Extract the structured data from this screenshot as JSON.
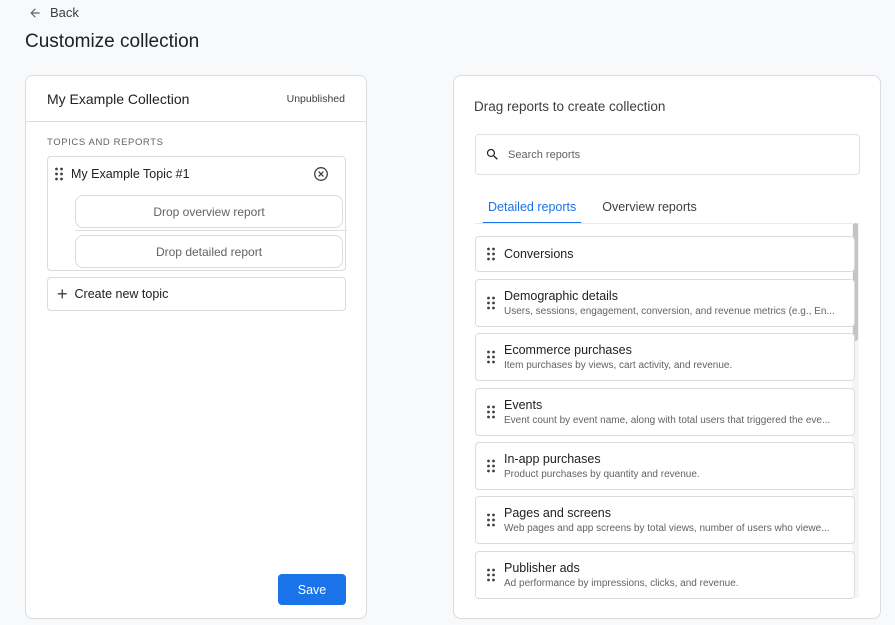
{
  "nav": {
    "back_label": "Back"
  },
  "page": {
    "title": "Customize collection"
  },
  "left_panel": {
    "collection_name": "My Example Collection",
    "status": "Unpublished",
    "section_label": "TOPICS AND REPORTS",
    "topic": {
      "name": "My Example Topic #1",
      "drop_overview": "Drop overview report",
      "drop_detailed": "Drop detailed report"
    },
    "create_topic_label": "Create new topic",
    "save_label": "Save"
  },
  "right_panel": {
    "title": "Drag reports to create collection",
    "search_placeholder": "Search reports",
    "tabs": [
      {
        "label": "Detailed reports",
        "active": true
      },
      {
        "label": "Overview reports",
        "active": false
      }
    ],
    "reports": [
      {
        "name": "Conversions",
        "description": ""
      },
      {
        "name": "Demographic details",
        "description": "Users, sessions, engagement, conversion, and revenue metrics (e.g., En..."
      },
      {
        "name": "Ecommerce purchases",
        "description": "Item purchases by views, cart activity, and revenue."
      },
      {
        "name": "Events",
        "description": "Event count by event name, along with total users that triggered the eve..."
      },
      {
        "name": "In-app purchases",
        "description": "Product purchases by quantity and revenue."
      },
      {
        "name": "Pages and screens",
        "description": "Web pages and app screens by total views, number of users who viewe..."
      },
      {
        "name": "Publisher ads",
        "description": "Ad performance by impressions, clicks, and revenue."
      }
    ]
  },
  "colors": {
    "accent": "#1a73e8",
    "border": "#dadce0",
    "background": "#f8f9fa"
  }
}
